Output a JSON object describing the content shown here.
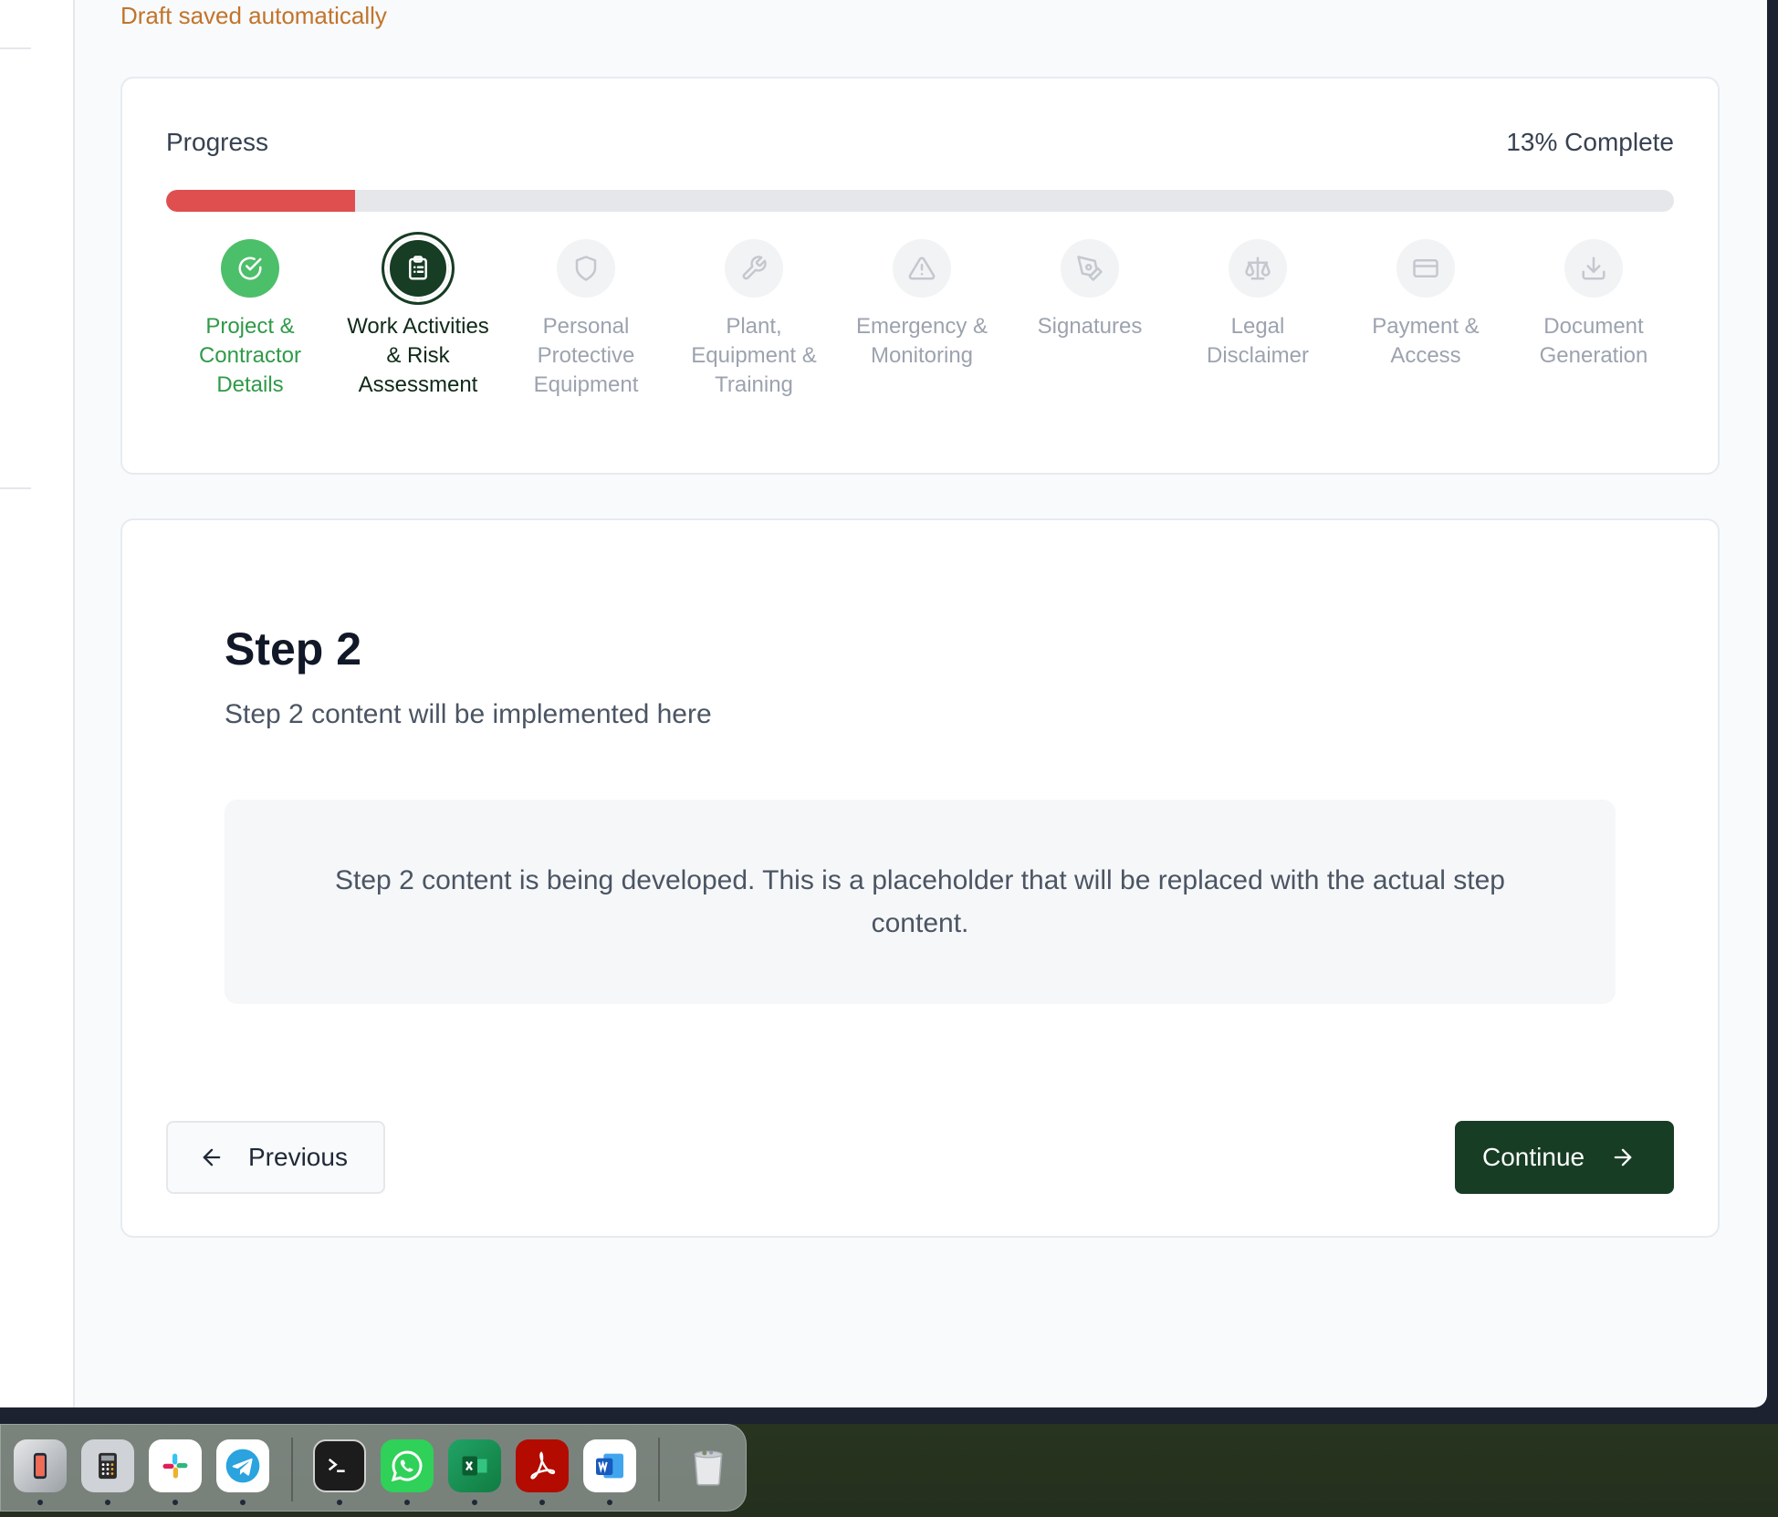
{
  "draft_status": "Draft saved automatically",
  "progress": {
    "label": "Progress",
    "percent_text": "13% Complete",
    "value": 0.125
  },
  "steps": [
    {
      "label": "Project & Contractor Details",
      "state": "completed",
      "icon": "check-circle-icon"
    },
    {
      "label": "Work Activities & Risk Assessment",
      "state": "current",
      "icon": "clipboard-list-icon"
    },
    {
      "label": "Personal Protective Equipment",
      "state": "pending",
      "icon": "shield-icon"
    },
    {
      "label": "Plant, Equipment & Training",
      "state": "pending",
      "icon": "wrench-icon"
    },
    {
      "label": "Emergency & Monitoring",
      "state": "pending",
      "icon": "warning-triangle-icon"
    },
    {
      "label": "Signatures",
      "state": "pending",
      "icon": "pen-tool-icon"
    },
    {
      "label": "Legal Disclaimer",
      "state": "pending",
      "icon": "scale-icon"
    },
    {
      "label": "Payment & Access",
      "state": "pending",
      "icon": "credit-card-icon"
    },
    {
      "label": "Document Generation",
      "state": "pending",
      "icon": "download-icon"
    }
  ],
  "content": {
    "title": "Step 2",
    "subtitle": "Step 2 content will be implemented here",
    "placeholder": "Step 2 content is being developed. This is a placeholder that will be replaced with the actual step content."
  },
  "nav": {
    "previous_label": "Previous",
    "continue_label": "Continue"
  },
  "colors": {
    "accent_dark_green": "#173d24",
    "completed_green": "#4cbf6a",
    "progress_red": "#e04f4f",
    "draft_orange": "#c2742a"
  },
  "dock": {
    "apps": [
      {
        "name": "iphone-mirroring-icon",
        "running": true
      },
      {
        "name": "calculator-icon",
        "running": true
      },
      {
        "name": "slack-icon",
        "running": true
      },
      {
        "name": "telegram-icon",
        "running": true
      },
      {
        "name": "terminal-icon",
        "running": true
      },
      {
        "name": "whatsapp-icon",
        "running": true
      },
      {
        "name": "excel-icon",
        "running": true
      },
      {
        "name": "acrobat-icon",
        "running": true
      },
      {
        "name": "word-icon",
        "running": true
      },
      {
        "name": "trash-icon",
        "running": false
      }
    ]
  }
}
